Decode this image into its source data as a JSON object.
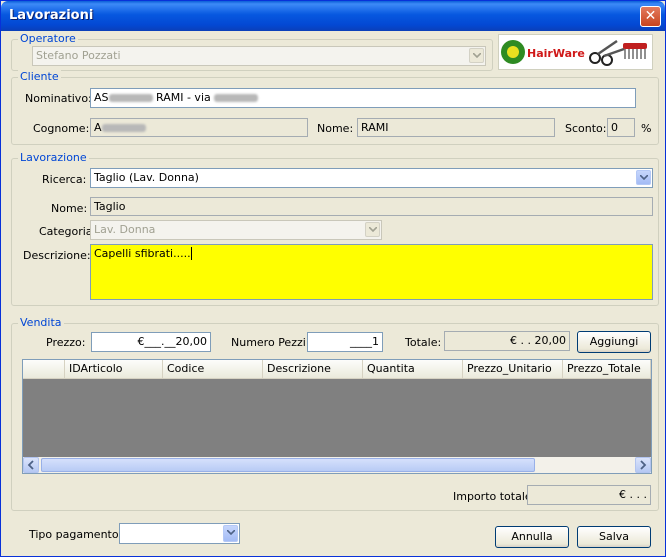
{
  "window": {
    "title": "Lavorazioni",
    "close_icon": "close-icon"
  },
  "operatore": {
    "legend": "Operatore",
    "value": "Stefano Pozzati"
  },
  "logo": {
    "text": "HairWare",
    "icon": "scissors-comb-logo"
  },
  "cliente": {
    "legend": "Cliente",
    "nominativo_label": "Nominativo:",
    "nominativo_prefix": "AS",
    "nominativo_mid": "RAMI - via",
    "cognome_label": "Cognome:",
    "cognome_prefix": "A",
    "nome_label": "Nome:",
    "nome_value": "RAMI",
    "sconto_label": "Sconto:",
    "sconto_value": "0",
    "sconto_unit": "%"
  },
  "lavorazione": {
    "legend": "Lavorazione",
    "ricerca_label": "Ricerca:",
    "ricerca_value": "Taglio (Lav. Donna)",
    "nome_label": "Nome:",
    "nome_value": "Taglio",
    "categoria_label": "Categoria:",
    "categoria_value": "Lav. Donna",
    "descrizione_label": "Descrizione:",
    "descrizione_value": "Capelli sfibrati....."
  },
  "vendita": {
    "legend": "Vendita",
    "prezzo_label": "Prezzo:",
    "prezzo_value": "€___.__20,00",
    "pezzi_label": "Numero Pezzi:",
    "pezzi_value": "____1",
    "totale_label": "Totale:",
    "totale_value": "€  .  . 20,00",
    "aggiungi_label": "Aggiungi",
    "columns": [
      "IDArticolo",
      "Codice",
      "Descrizione",
      "Quantita",
      "Prezzo_Unitario",
      "Prezzo_Totale"
    ],
    "importo_label": "Importo totale:",
    "importo_value": "€  .  .  ."
  },
  "footer": {
    "pagamento_label": "Tipo pagamento:",
    "pagamento_value": "",
    "annulla_label": "Annulla",
    "salva_label": "Salva"
  }
}
